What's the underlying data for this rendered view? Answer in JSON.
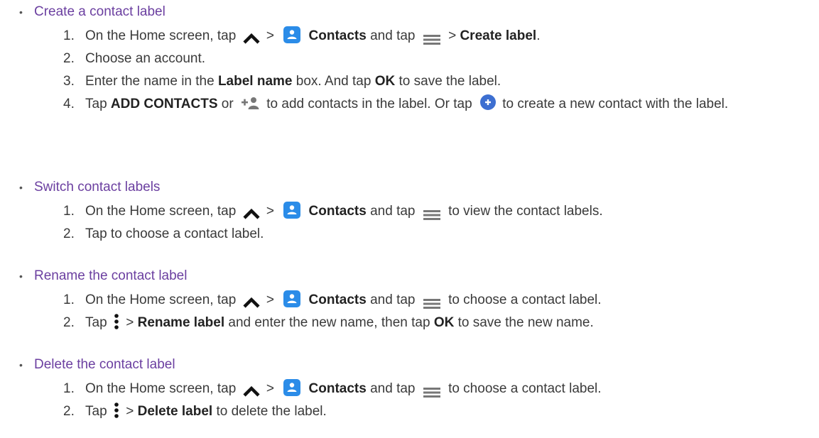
{
  "sections": [
    {
      "title": "Create a contact label",
      "steps": [
        {
          "num": "1.",
          "parts": [
            "On the Home screen, tap",
            ">",
            "Contacts",
            "and tap",
            ">",
            "Create label",
            "."
          ]
        },
        {
          "num": "2.",
          "text": "Choose an account."
        },
        {
          "num": "3.",
          "parts": [
            "Enter the name in the",
            "Label name",
            "box. And tap",
            "OK",
            "to save the label."
          ]
        },
        {
          "num": "4.",
          "parts": [
            "Tap",
            "ADD CONTACTS",
            "or",
            "to add contacts in the label. Or tap",
            "to create a new contact with the label."
          ]
        }
      ]
    },
    {
      "title": "Switch contact labels",
      "steps": [
        {
          "num": "1.",
          "parts": [
            "On the Home screen, tap",
            ">",
            "Contacts",
            "and tap",
            "to view the contact labels."
          ]
        },
        {
          "num": "2.",
          "text": "Tap to choose a contact label."
        }
      ]
    },
    {
      "title": "Rename the contact label",
      "steps": [
        {
          "num": "1.",
          "parts": [
            "On the Home screen, tap",
            ">",
            "Contacts",
            "and tap",
            "to choose a contact label."
          ]
        },
        {
          "num": "2.",
          "parts": [
            "Tap",
            ">",
            "Rename label",
            "and enter the new name, then tap",
            "OK",
            "to save the new name."
          ]
        }
      ]
    },
    {
      "title": "Delete the contact label",
      "steps": [
        {
          "num": "1.",
          "parts": [
            "On the Home screen, tap",
            ">",
            "Contacts",
            "and tap",
            "to choose a contact label."
          ]
        },
        {
          "num": "2.",
          "parts": [
            "Tap",
            ">",
            "Delete label",
            "to delete the label."
          ]
        }
      ]
    }
  ],
  "bullet": "•",
  "colors": {
    "heading": "#6b3fa0",
    "body": "#3a3a3a",
    "contacts_icon": "#2b8ce8",
    "fab": "#3d6fd1"
  },
  "icons": [
    "chevron-up-icon",
    "contacts-app-icon",
    "menu-icon",
    "add-contact-icon",
    "fab-add-icon",
    "overflow-icon"
  ]
}
